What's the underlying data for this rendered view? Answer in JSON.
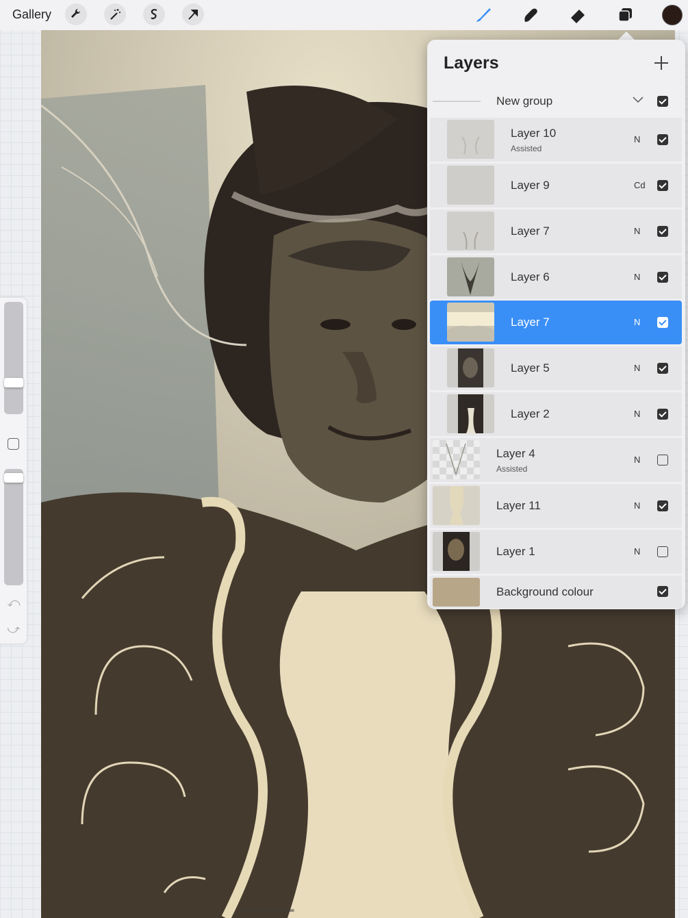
{
  "toolbar": {
    "gallery_label": "Gallery",
    "left_tools": [
      "wrench-icon",
      "magic-wand-icon",
      "selection-icon",
      "transform-arrow-icon"
    ],
    "right_tools": [
      "brush-icon",
      "smudge-icon",
      "eraser-icon",
      "layers-icon"
    ],
    "current_color": "#2b1b17",
    "accent_color": "#3a8ff7"
  },
  "layers_panel": {
    "title": "Layers",
    "group": {
      "name": "New group",
      "visible": true
    },
    "layers": [
      {
        "name": "Layer 10",
        "sub": "Assisted",
        "blend": "N",
        "visible": true,
        "selected": false,
        "indent": true
      },
      {
        "name": "Layer 9",
        "sub": "",
        "blend": "Cd",
        "visible": true,
        "selected": false,
        "indent": true
      },
      {
        "name": "Layer 7",
        "sub": "",
        "blend": "N",
        "visible": true,
        "selected": false,
        "indent": true
      },
      {
        "name": "Layer 6",
        "sub": "",
        "blend": "N",
        "visible": true,
        "selected": false,
        "indent": true
      },
      {
        "name": "Layer 7",
        "sub": "",
        "blend": "N",
        "visible": true,
        "selected": true,
        "indent": true
      },
      {
        "name": "Layer 5",
        "sub": "",
        "blend": "N",
        "visible": true,
        "selected": false,
        "indent": true
      },
      {
        "name": "Layer 2",
        "sub": "",
        "blend": "N",
        "visible": true,
        "selected": false,
        "indent": true
      },
      {
        "name": "Layer 4",
        "sub": "Assisted",
        "blend": "N",
        "visible": false,
        "selected": false,
        "indent": false
      },
      {
        "name": "Layer 11",
        "sub": "",
        "blend": "N",
        "visible": true,
        "selected": false,
        "indent": false
      },
      {
        "name": "Layer 1",
        "sub": "",
        "blend": "N",
        "visible": false,
        "selected": false,
        "indent": false
      }
    ],
    "background": {
      "name": "Background colour",
      "color": "#b8a688",
      "visible": true
    }
  }
}
